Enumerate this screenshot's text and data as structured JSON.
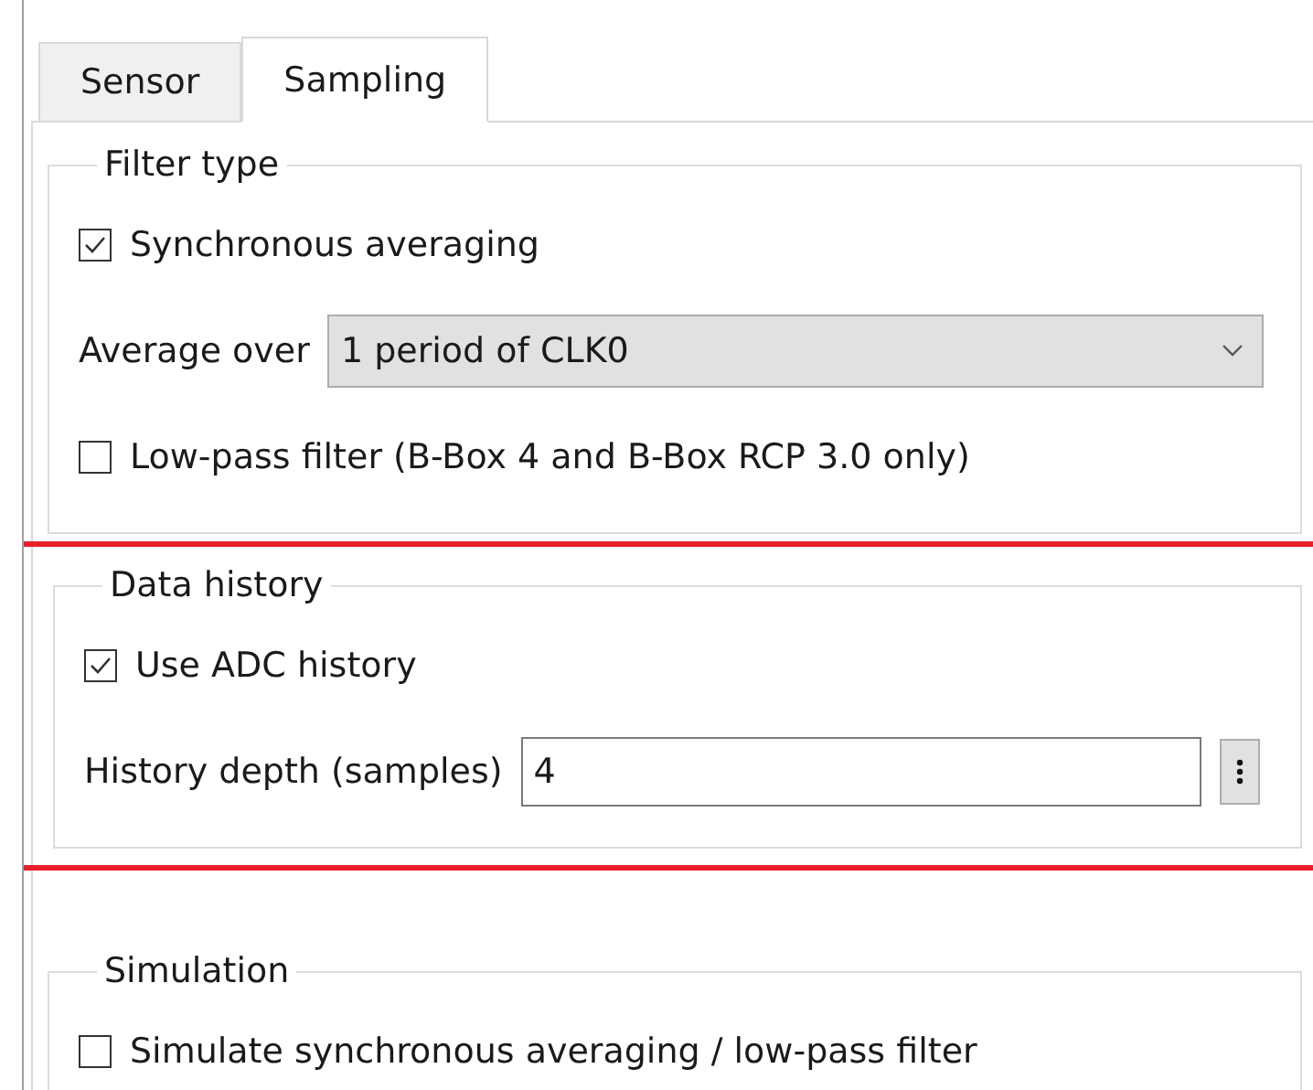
{
  "tabs": [
    {
      "label": "Sensor",
      "selected": false
    },
    {
      "label": "Sampling",
      "selected": true
    }
  ],
  "groups": [
    {
      "title": "Filter type",
      "highlighted": false,
      "rows": [
        {
          "kind": "checkbox",
          "label": "Synchronous averaging",
          "checked": true
        },
        {
          "kind": "combo",
          "label": "Average over",
          "value": "1 period of CLK0"
        },
        {
          "kind": "checkbox",
          "label": "Low-pass filter (B-Box 4 and B-Box RCP 3.0 only)",
          "checked": false
        }
      ]
    },
    {
      "title": "Data history",
      "highlighted": true,
      "rows": [
        {
          "kind": "checkbox",
          "label": "Use ADC history",
          "checked": true
        },
        {
          "kind": "spin",
          "label": "History depth (samples)",
          "value": "4"
        }
      ]
    },
    {
      "title": "Simulation",
      "highlighted": false,
      "rows": [
        {
          "kind": "checkbox",
          "label": "Simulate synchronous averaging / low-pass filter",
          "checked": false
        }
      ]
    }
  ]
}
